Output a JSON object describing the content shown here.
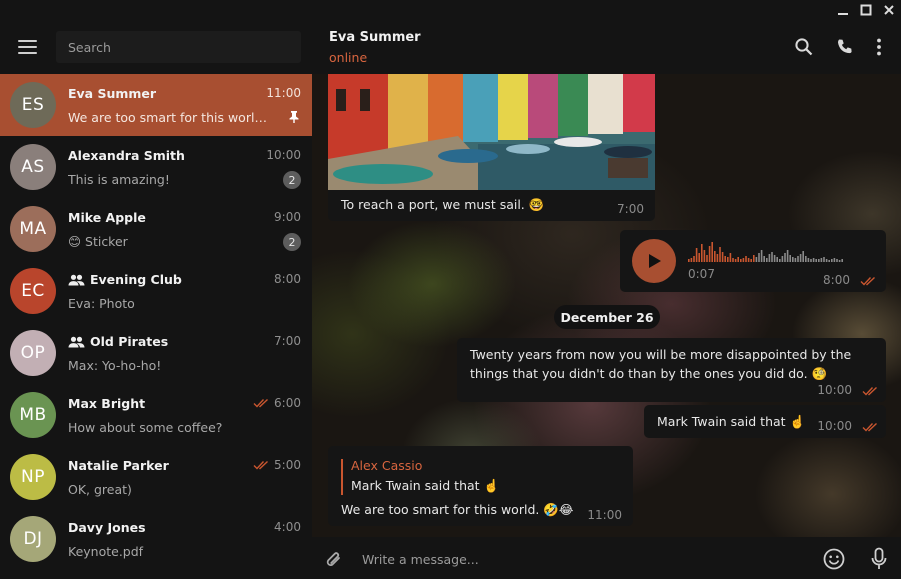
{
  "search": {
    "placeholder": "Search"
  },
  "colors": {
    "accent": "#a84f31",
    "online": "#d8653f",
    "sidebar_bg": "#141414"
  },
  "chats": [
    {
      "initials": "ES",
      "name": "Eva Summer",
      "time": "11:00",
      "preview": "We are too smart for this world. …",
      "pinned": true,
      "avatar_color": "#6e6a58",
      "active": true
    },
    {
      "initials": "AS",
      "name": "Alexandra Smith",
      "time": "10:00",
      "preview": "This is amazing!",
      "badge": "2",
      "avatar_color": "#8a7f7b"
    },
    {
      "initials": "MA",
      "name": "Mike Apple",
      "time": "9:00",
      "preview": "😊 Sticker",
      "badge": "2",
      "avatar_color": "#9c6e5b"
    },
    {
      "initials": "EC",
      "name": "Evening Club",
      "time": "8:00",
      "preview": "Eva: Photo",
      "group": true,
      "avatar_color": "#b9452c"
    },
    {
      "initials": "OP",
      "name": "Old Pirates",
      "time": "7:00",
      "preview": "Max: Yo-ho-ho!",
      "group": true,
      "avatar_color": "#c2afb4"
    },
    {
      "initials": "MB",
      "name": "Max Bright",
      "time": "6:00",
      "preview": "How about some coffee?",
      "read": true,
      "avatar_color": "#6a9452"
    },
    {
      "initials": "NP",
      "name": "Natalie Parker",
      "time": "5:00",
      "preview": "OK, great)",
      "read": true,
      "avatar_color": "#bcbc45"
    },
    {
      "initials": "DJ",
      "name": "Davy Jones",
      "time": "4:00",
      "preview": "Keynote.pdf",
      "avatar_color": "#a5a778"
    }
  ],
  "conversation": {
    "title": "Eva Summer",
    "status": "online",
    "photo_caption": "To reach a port, we must sail. 🤓",
    "photo_time": "7:00",
    "voice_duration": "0:07",
    "voice_time": "8:00",
    "date_separator": "December 26",
    "msg1_text": "Twenty years from now you will be more disappointed by the things that you didn't do than by the ones you did do. 🧐",
    "msg1_time": "10:00",
    "msg2_text": "Mark Twain said that ☝️",
    "msg2_time": "10:00",
    "reply_author": "Alex Cassio",
    "reply_quote": "Mark Twain said that ☝️",
    "reply_text": "We are too smart for this world. 🤣😂",
    "reply_time": "11:00"
  },
  "composer": {
    "placeholder": "Write a message..."
  }
}
